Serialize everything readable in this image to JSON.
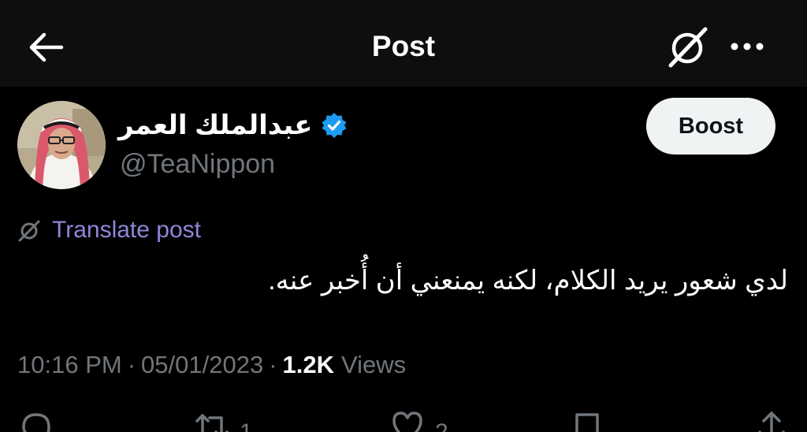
{
  "header": {
    "title": "Post",
    "back_icon": "arrow-left-icon",
    "grok_icon": "grok-icon",
    "more_icon": "more-horizontal-icon"
  },
  "author": {
    "display_name": "عبدالملك العمر",
    "handle": "@TeaNippon",
    "verified": true,
    "verified_color": "#1d9bf0"
  },
  "boost_button": {
    "label": "Boost"
  },
  "translate": {
    "label": "Translate post",
    "icon": "translate-icon",
    "color": "#8f87d9"
  },
  "post": {
    "text": "لدي شعور يريد الكلام، لكنه يمنعني أن أُخبر عنه."
  },
  "meta": {
    "time": "10:16 PM",
    "separator": "·",
    "date": "05/01/2023",
    "views_count": "1.2K",
    "views_label": "Views"
  },
  "actions": {
    "reply": {
      "icon": "reply-icon",
      "count": ""
    },
    "repost": {
      "icon": "repost-icon",
      "count": "1"
    },
    "like": {
      "icon": "heart-icon",
      "count": "2"
    },
    "bookmark": {
      "icon": "bookmark-icon",
      "count": ""
    },
    "share": {
      "icon": "share-icon",
      "count": ""
    }
  },
  "colors": {
    "background": "#000000",
    "header_background": "#0e0e0f",
    "secondary_text": "#71767b",
    "primary_text": "#ffffff"
  }
}
